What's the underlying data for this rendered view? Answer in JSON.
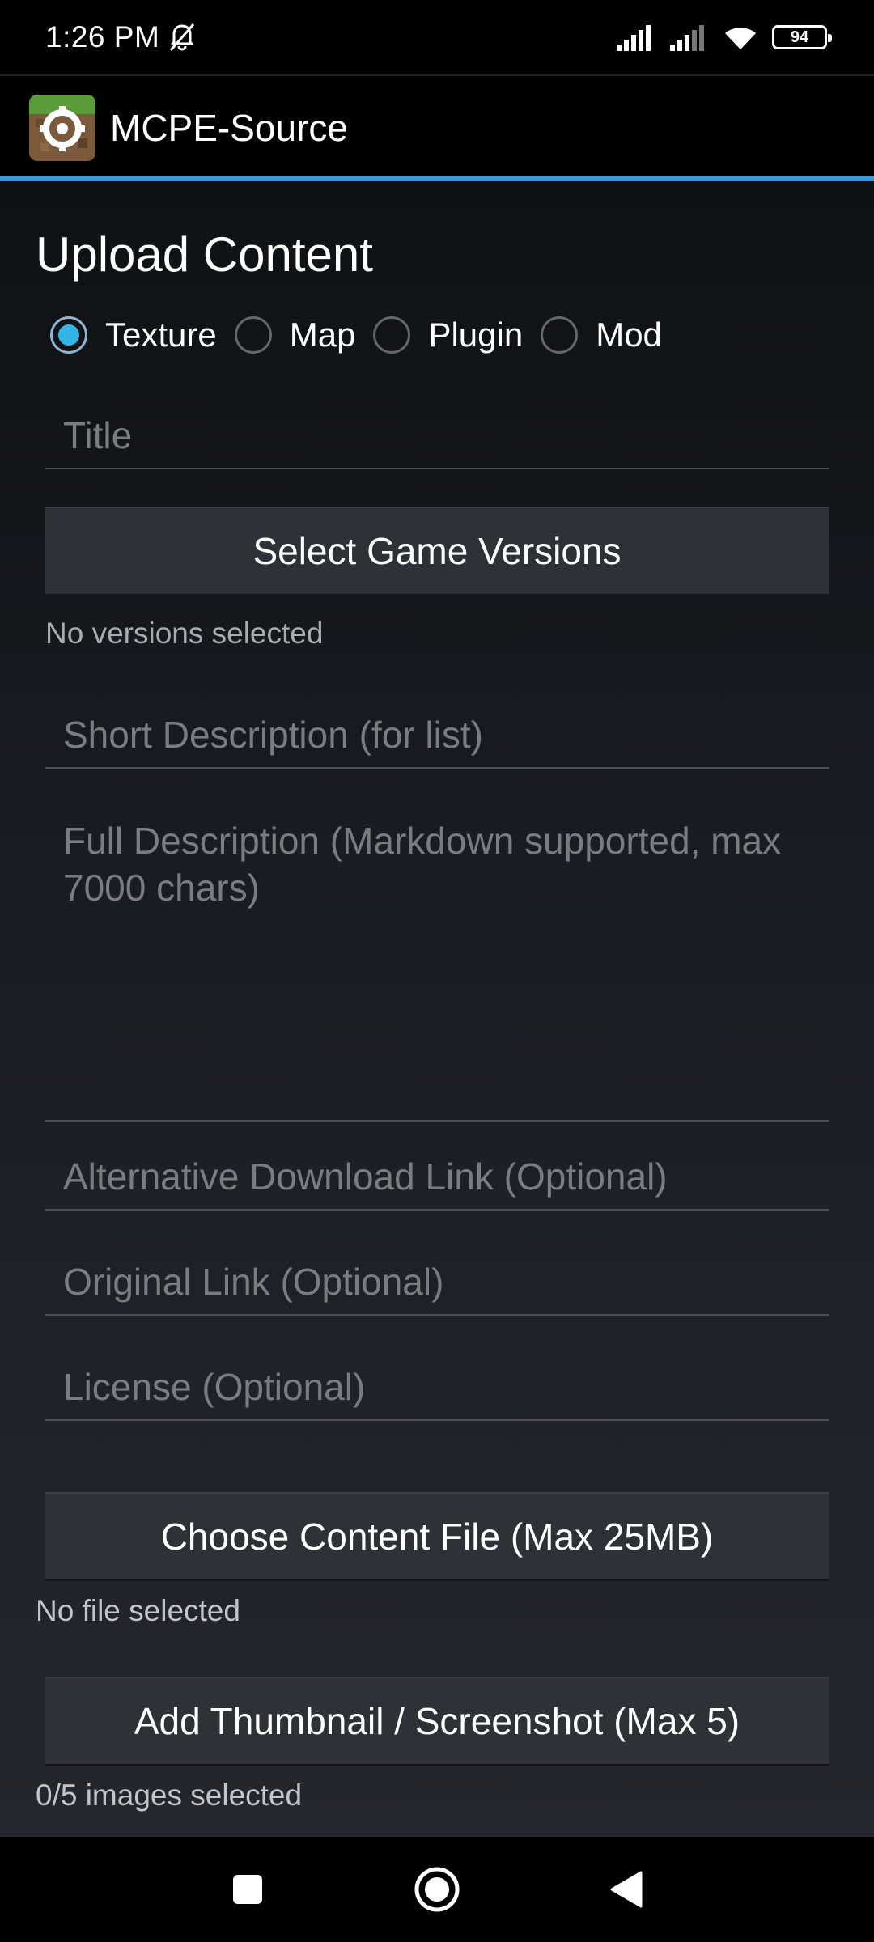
{
  "status_bar": {
    "time": "1:26 PM",
    "battery": "94",
    "icons": [
      "alarm-off-icon",
      "signal-icon",
      "signal-icon-2",
      "wifi-icon",
      "battery-icon"
    ]
  },
  "app_bar": {
    "title": "MCPE-Source",
    "icon": "app-logo-icon"
  },
  "form": {
    "heading": "Upload Content",
    "content_types": [
      {
        "label": "Texture",
        "checked": true
      },
      {
        "label": "Map",
        "checked": false
      },
      {
        "label": "Plugin",
        "checked": false
      },
      {
        "label": "Mod",
        "checked": false
      }
    ],
    "title_placeholder": "Title",
    "select_versions_label": "Select Game Versions",
    "versions_status": "No versions selected",
    "short_description_placeholder": "Short Description (for list)",
    "full_description_placeholder": "Full Description (Markdown supported, max 7000 chars)",
    "alt_link_placeholder": "Alternative Download Link (Optional)",
    "original_link_placeholder": "Original Link (Optional)",
    "license_placeholder": "License (Optional)",
    "choose_file_label": "Choose Content File (Max 25MB)",
    "file_status": "No file selected",
    "add_thumbnail_label": "Add Thumbnail / Screenshot (Max 5)",
    "images_status": "0/5 images selected"
  },
  "nav_bar": {
    "icons": [
      "recents-square-icon",
      "home-circle-icon",
      "back-triangle-icon"
    ]
  },
  "colors": {
    "accent": "#33b5e5",
    "divider": "#3a9ad6",
    "button_bg": "#2f3136",
    "hint": "#a9abaf"
  }
}
